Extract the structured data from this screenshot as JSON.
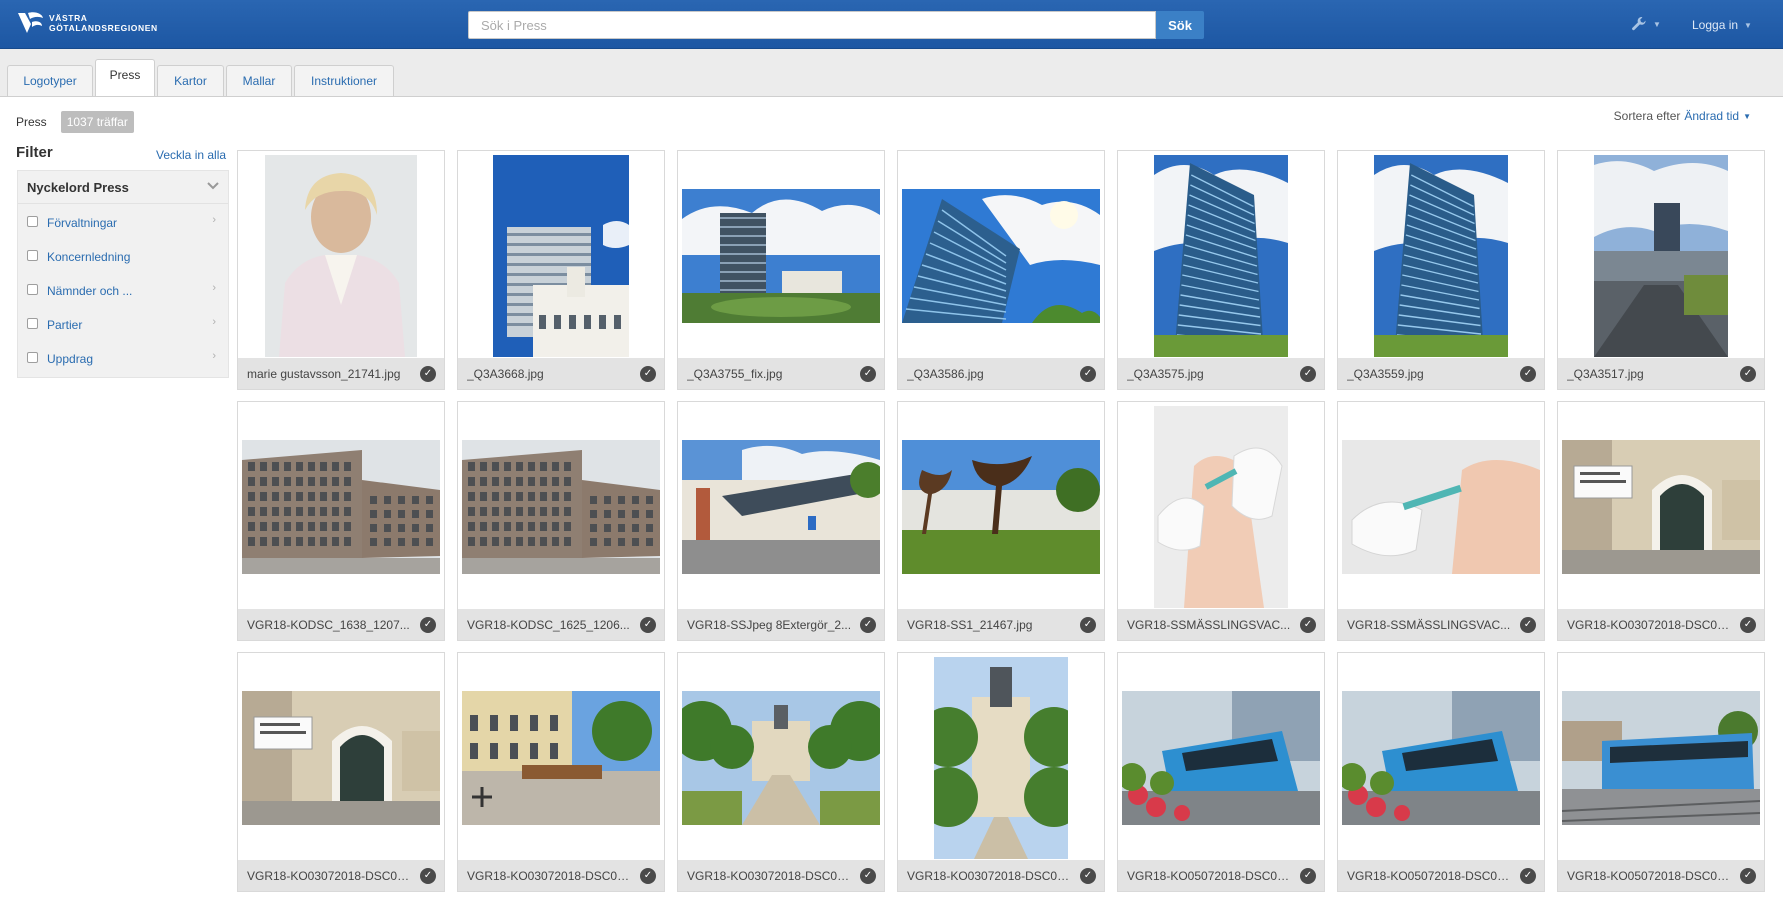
{
  "header": {
    "logo_line1": "VÄSTRA",
    "logo_line2": "GÖTALANDSREGIONEN",
    "search_placeholder": "Sök i Press",
    "search_button": "Sök",
    "tools_icon": "wrench-icon",
    "login_label": "Logga in"
  },
  "tabs": [
    {
      "label": "Logotyper",
      "active": false
    },
    {
      "label": "Press",
      "active": true
    },
    {
      "label": "Kartor",
      "active": false
    },
    {
      "label": "Mallar",
      "active": false
    },
    {
      "label": "Instruktioner",
      "active": false
    }
  ],
  "breadcrumb": {
    "section": "Press",
    "hits": "1037 träffar"
  },
  "sort": {
    "label": "Sortera efter",
    "value": "Ändrad tid"
  },
  "filter": {
    "title": "Filter",
    "collapse_all": "Veckla in alla",
    "group_label": "Nyckelord Press",
    "items": [
      {
        "label": "Förvaltningar",
        "has_children": true
      },
      {
        "label": "Koncernledning",
        "has_children": false
      },
      {
        "label": "Nämnder och ...",
        "has_children": true
      },
      {
        "label": "Partier",
        "has_children": true
      },
      {
        "label": "Uppdrag",
        "has_children": true
      }
    ]
  },
  "images": [
    {
      "caption": "marie gustavsson_21741.jpg",
      "thumb": "portrait"
    },
    {
      "caption": "_Q3A3668.jpg",
      "thumb": "tower-tall"
    },
    {
      "caption": "_Q3A3755_fix.jpg",
      "thumb": "tower-wide"
    },
    {
      "caption": "_Q3A3586.jpg",
      "thumb": "glass-wide"
    },
    {
      "caption": "_Q3A3575.jpg",
      "thumb": "glass-tall"
    },
    {
      "caption": "_Q3A3559.jpg",
      "thumb": "glass-tall"
    },
    {
      "caption": "_Q3A3517.jpg",
      "thumb": "city-tall"
    },
    {
      "caption": "VGR18-KODSC_1638_1207...",
      "thumb": "office-wide"
    },
    {
      "caption": "VGR18-KODSC_1625_1206...",
      "thumb": "office-wide"
    },
    {
      "caption": "VGR18-SSJpeg 8Extergör_2...",
      "thumb": "hospital-wide"
    },
    {
      "caption": "VGR18-SS1_21467.jpg",
      "thumb": "sculpture-wide"
    },
    {
      "caption": "VGR18-SSMÄSSLINGSVAC...",
      "thumb": "vaccine-tall"
    },
    {
      "caption": "VGR18-SSMÄSSLINGSVAC...",
      "thumb": "vaccine-wide"
    },
    {
      "caption": "VGR18-KO03072018-DSC01...",
      "thumb": "entrance-wide"
    },
    {
      "caption": "VGR18-KO03072018-DSC01...",
      "thumb": "entrance-wide"
    },
    {
      "caption": "VGR18-KO03072018-DSC01...",
      "thumb": "courtyard-wide"
    },
    {
      "caption": "VGR18-KO03072018-DSC01...",
      "thumb": "alley-wide"
    },
    {
      "caption": "VGR18-KO03072018-DSC01...",
      "thumb": "alley-tall"
    },
    {
      "caption": "VGR18-KO05072018-DSC01...",
      "thumb": "bus-wide"
    },
    {
      "caption": "VGR18-KO05072018-DSC01...",
      "thumb": "bus-wide"
    },
    {
      "caption": "VGR18-KO05072018-DSC01...",
      "thumb": "tram-wide"
    }
  ],
  "colors": {
    "header": "#1d57a3",
    "link": "#2a6cb0",
    "search_button": "#3b80c6"
  }
}
